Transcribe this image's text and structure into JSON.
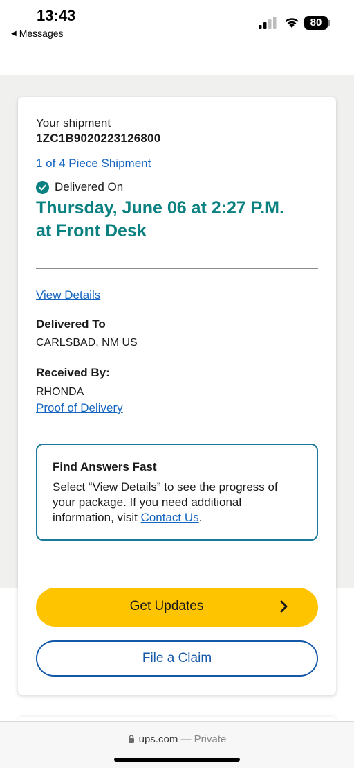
{
  "status_bar": {
    "time": "13:43",
    "back_app": "Messages",
    "battery": "80"
  },
  "shipment": {
    "label": "Your shipment",
    "tracking_number": "1ZC1B9020223126800",
    "piece_link": "1 of 4 Piece Shipment",
    "status_label": "Delivered On",
    "delivered_date_line1": "Thursday, June 06 at 2:27 P.M.",
    "delivered_date_line2": "at Front Desk",
    "view_details": "View Details",
    "delivered_to_heading": "Delivered To",
    "delivered_to_value": "CARLSBAD, NM US",
    "received_by_heading": "Received By:",
    "received_by_value": "RHONDA",
    "proof_link": "Proof of Delivery"
  },
  "answers": {
    "title": "Find Answers Fast",
    "text_before": "Select “View Details” to see the progress of your package. If you need additional information, visit ",
    "link": "Contact Us",
    "text_after": "."
  },
  "actions": {
    "get_updates": "Get Updates",
    "file_claim": "File a Claim"
  },
  "browser": {
    "domain": "ups.com",
    "separator": " — ",
    "mode": "Private"
  },
  "colors": {
    "accent_teal": "#0a8080",
    "link_blue": "#1565c0",
    "button_yellow": "#ffc400",
    "claim_blue": "#1558a8"
  },
  "icons": {
    "status": "check-circle-icon",
    "button_arrow": "chevron-right-icon",
    "url_lock": "lock-icon"
  }
}
